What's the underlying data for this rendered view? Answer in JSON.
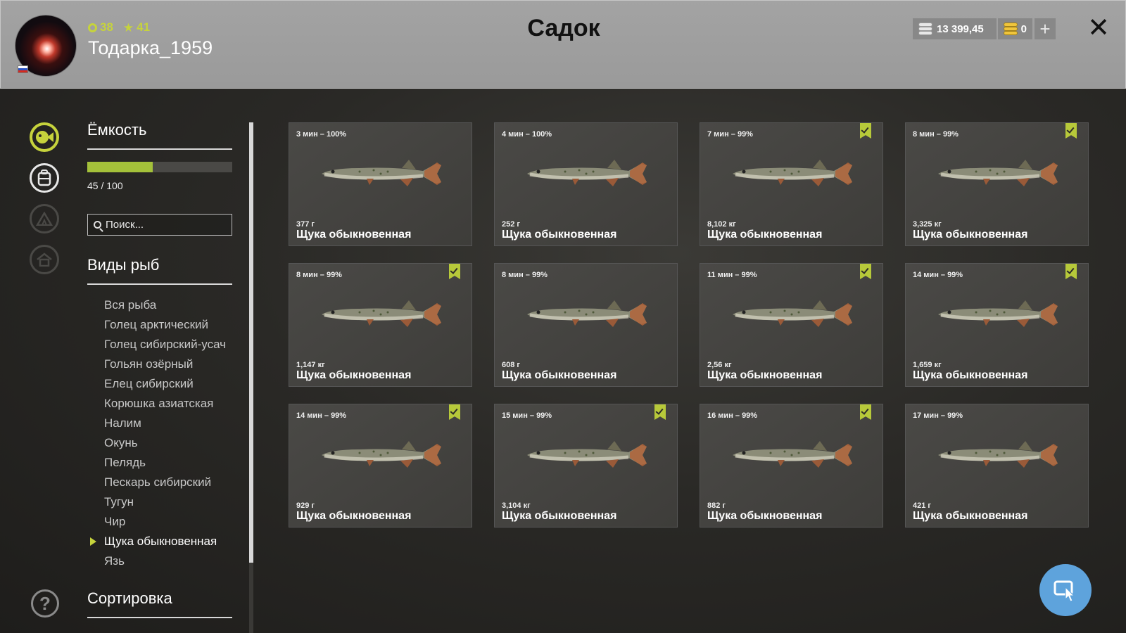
{
  "header": {
    "title": "Садок",
    "username": "Тодарка_1959",
    "level": "38",
    "rank": "41",
    "silver": "13 399,45",
    "gold": "0",
    "add_label": "+",
    "close_label": "✕"
  },
  "sidebar": {
    "capacity_title": "Ёмкость",
    "capacity_fill": 0.45,
    "capacity_text": "45 / 100",
    "search_placeholder": "Поиск...",
    "species_title": "Виды рыб",
    "species": [
      "Вся рыба",
      "Голец арктический",
      "Голец сибирский-усач",
      "Гольян озёрный",
      "Елец сибирский",
      "Корюшка азиатская",
      "Налим",
      "Окунь",
      "Пелядь",
      "Пескарь сибирский",
      "Тугун",
      "Чир",
      "Щука обыкновенная",
      "Язь"
    ],
    "selected_species_index": 12,
    "sort_title": "Сортировка",
    "help_label": "?"
  },
  "cards": [
    {
      "time": "3 мин – 100%",
      "weight": "377 г",
      "name": "Щука обыкновенная",
      "bookmarked": false
    },
    {
      "time": "4 мин – 100%",
      "weight": "252 г",
      "name": "Щука обыкновенная",
      "bookmarked": false
    },
    {
      "time": "7 мин – 99%",
      "weight": "8,102 кг",
      "name": "Щука обыкновенная",
      "bookmarked": true
    },
    {
      "time": "8 мин – 99%",
      "weight": "3,325 кг",
      "name": "Щука обыкновенная",
      "bookmarked": true
    },
    {
      "time": "8 мин – 99%",
      "weight": "1,147 кг",
      "name": "Щука обыкновенная",
      "bookmarked": true
    },
    {
      "time": "8 мин – 99%",
      "weight": "608 г",
      "name": "Щука обыкновенная",
      "bookmarked": false
    },
    {
      "time": "11 мин – 99%",
      "weight": "2,56 кг",
      "name": "Щука обыкновенная",
      "bookmarked": true
    },
    {
      "time": "14 мин – 99%",
      "weight": "1,659 кг",
      "name": "Щука обыкновенная",
      "bookmarked": true
    },
    {
      "time": "14 мин – 99%",
      "weight": "929 г",
      "name": "Щука обыкновенная",
      "bookmarked": true
    },
    {
      "time": "15 мин – 99%",
      "weight": "3,104 кг",
      "name": "Щука обыкновенная",
      "bookmarked": true
    },
    {
      "time": "16 мин – 99%",
      "weight": "882 г",
      "name": "Щука обыкновенная",
      "bookmarked": true
    },
    {
      "time": "17 мин – 99%",
      "weight": "421 г",
      "name": "Щука обыкновенная",
      "bookmarked": false
    }
  ],
  "colors": {
    "accent": "#c6d33c",
    "bookmark": "#b7c93a",
    "capacity_fill": "#a4c13a",
    "fab": "#5ea3dc"
  },
  "icons": {
    "rail": [
      "fish-icon",
      "backpack-icon",
      "tent-icon",
      "home-icon"
    ],
    "fab": "cursor-icon"
  }
}
